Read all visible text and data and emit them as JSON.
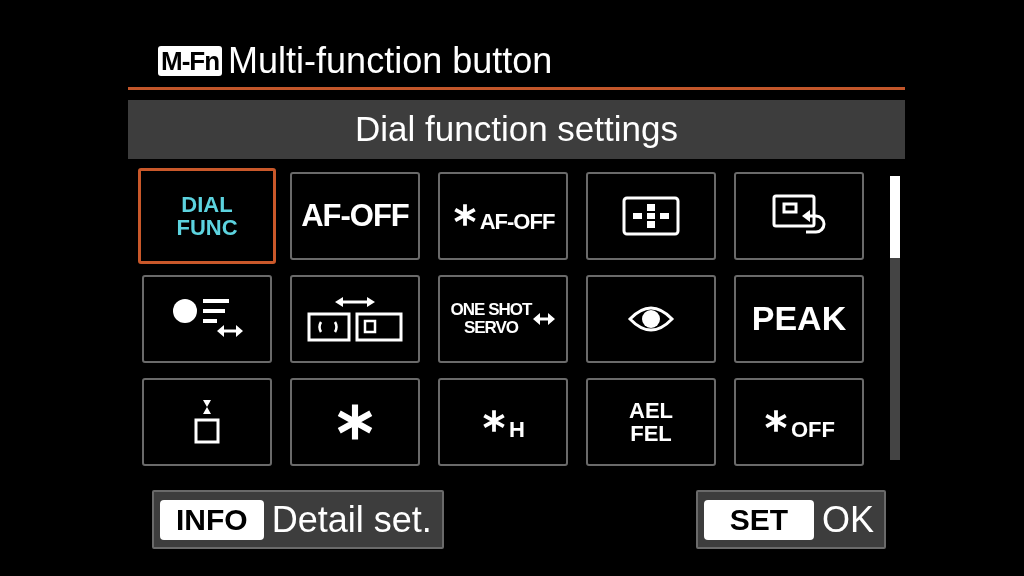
{
  "header": {
    "badge": "M-Fn",
    "title": "Multi-function button"
  },
  "subtitle": "Dial function settings",
  "options": [
    {
      "kind": "label",
      "lines": [
        "DIAL",
        "FUNC"
      ],
      "selected": true
    },
    {
      "kind": "label",
      "lines": [
        "AF-OFF"
      ],
      "selected": false
    },
    {
      "kind": "starlabel",
      "lines": [
        "AF-OFF"
      ],
      "selected": false
    },
    {
      "kind": "afpoint",
      "selected": false
    },
    {
      "kind": "playback",
      "selected": false
    },
    {
      "kind": "metering",
      "selected": false
    },
    {
      "kind": "afarea",
      "selected": false
    },
    {
      "kind": "labelarrow",
      "lines": [
        "ONE SHOT",
        "SERVO"
      ],
      "selected": false
    },
    {
      "kind": "eye",
      "selected": false
    },
    {
      "kind": "label",
      "lines": [
        "PEAK"
      ],
      "selected": false
    },
    {
      "kind": "dof",
      "selected": false
    },
    {
      "kind": "star",
      "selected": false
    },
    {
      "kind": "starlabel",
      "lines": [
        "H"
      ],
      "selected": false
    },
    {
      "kind": "label",
      "lines": [
        "AEL",
        "FEL"
      ],
      "selected": false
    },
    {
      "kind": "starlabel",
      "lines": [
        "OFF"
      ],
      "selected": false
    }
  ],
  "footer": [
    {
      "key": "INFO",
      "label": "Detail set."
    },
    {
      "key": "SET",
      "label": "OK"
    }
  ]
}
